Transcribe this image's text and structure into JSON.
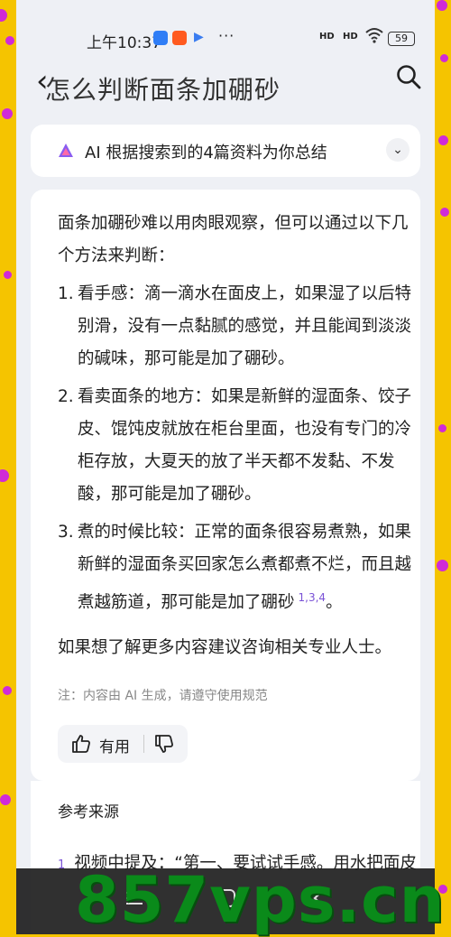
{
  "status_bar": {
    "time": "上午10:37",
    "signal_1": "HD",
    "signal_2": "HD",
    "battery": "59"
  },
  "header": {
    "title": "怎么判断面条加硼砂"
  },
  "ai_summary": {
    "label": "AI 根据搜索到的4篇资料为你总结"
  },
  "answer": {
    "intro": "面条加硼砂难以用肉眼观察，但可以通过以下几个方法来判断：",
    "items": [
      {
        "num": "1.",
        "text": "看手感：滴一滴水在面皮上，如果湿了以后特别滑，没有一点黏腻的感觉，并且能闻到淡淡的碱味，那可能是加了硼砂。"
      },
      {
        "num": "2.",
        "text": "看卖面条的地方：如果是新鲜的湿面条、饺子皮、馄饨皮就放在柜台里面，也没有专门的冷柜存放，大夏天的放了半天都不发黏、不发酸，那可能是加了硼砂。"
      },
      {
        "num": "3.",
        "text": "煮的时候比较：正常的面条很容易煮熟，如果新鲜的湿面条买回家怎么煮都煮不烂，而且越煮越筋道，那可能是加了硼砂",
        "cite": "1,3,4",
        "tail": "。"
      }
    ],
    "closing": "如果想了解更多内容建议咨询相关专业人士。",
    "note": "注：内容由 AI 生成，请遵守使用规范",
    "like_label": "有用"
  },
  "sources": {
    "heading": "参考来源",
    "items": [
      {
        "num": "1",
        "text": "视频中提及：“第一、要试试手感。用水把面皮"
      }
    ]
  },
  "watermark": "857vps.cn",
  "colors": {
    "outer_bg": "#f5c400",
    "page_bg": "#eef0f5",
    "accent_purple": "#7a52d6",
    "watermark_green": "#0a8a1a"
  }
}
